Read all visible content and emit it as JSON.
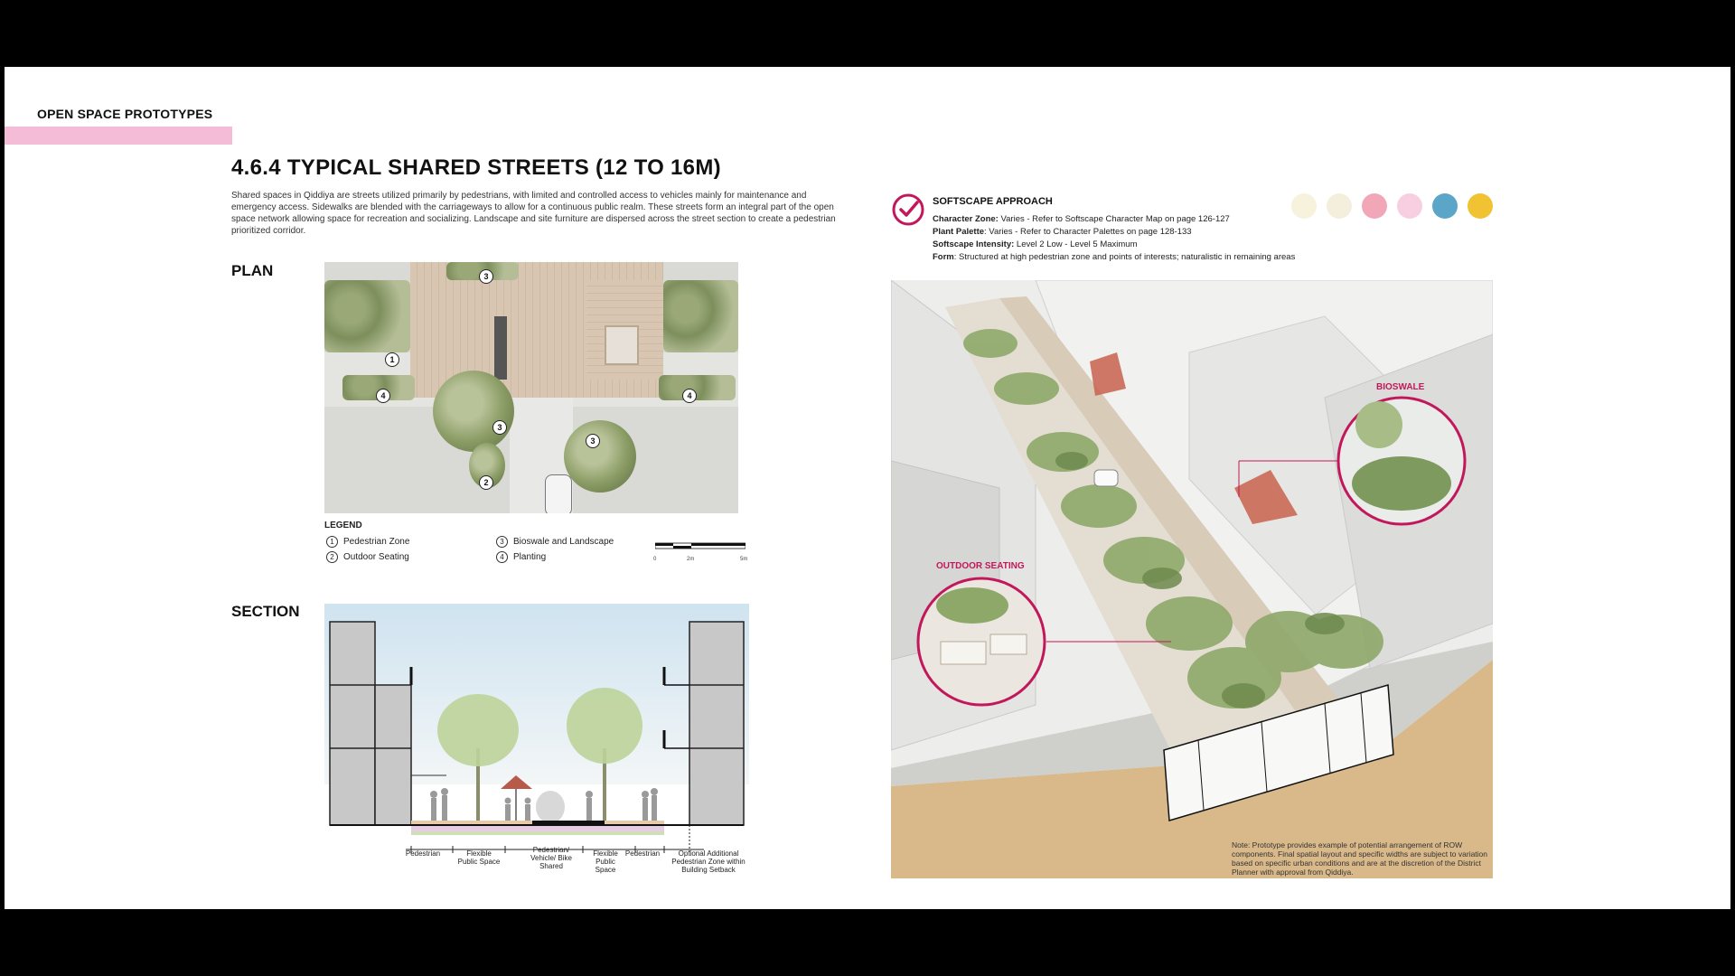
{
  "header": {
    "eyebrow": "OPEN SPACE PROTOTYPES",
    "title": "4.6.4 TYPICAL SHARED STREETS (12 TO 16M)",
    "intro": "Shared spaces in Qiddiya are streets utilized primarily by pedestrians, with limited and controlled access to vehicles mainly for maintenance and emergency access. Sidewalks are blended with the carriageways to allow for a continuous public realm. These streets form an integral part of the open space network allowing space for recreation and socializing. Landscape and site furniture are dispersed across the street section to create a pedestrian prioritized corridor."
  },
  "plan": {
    "label": "PLAN",
    "legend_title": "LEGEND",
    "legend": [
      {
        "num": "1",
        "text": "Pedestrian Zone"
      },
      {
        "num": "2",
        "text": "Outdoor Seating"
      },
      {
        "num": "3",
        "text": "Bioswale and Landscape"
      },
      {
        "num": "4",
        "text": "Planting"
      }
    ],
    "scale": {
      "s0": "0",
      "s1": "2m",
      "s2": "5m"
    },
    "pins": [
      "3",
      "1",
      "4",
      "4",
      "3",
      "3",
      "2"
    ]
  },
  "section": {
    "label": "SECTION",
    "zones": [
      "Pedestrian",
      "Flexible Public Space",
      "Pedestrian/ Vehicle/ Bike Shared",
      "Flexible Public Space",
      "Pedestrian",
      "Optional Additional Pedestrian Zone within Building Setback"
    ]
  },
  "softscape": {
    "title": "SOFTSCAPE APPROACH",
    "character_zone_label": "Character Zone:",
    "character_zone": "Varies - Refer to Softscape Character Map on page 126-127",
    "plant_palette_label": "Plant Palette",
    "plant_palette": ": Varies - Refer to Character Palettes on page 128-133",
    "intensity_label": "Softscape Intensity:",
    "intensity": "Level 2 Low - Level 5 Maximum",
    "form_label": "Form",
    "form": ": Structured at high pedestrian zone and points of interests; naturalistic in remaining areas",
    "icons": [
      {
        "name": "character-icon-1",
        "color": "#f6f2dc"
      },
      {
        "name": "character-icon-2",
        "color": "#f3efdc"
      },
      {
        "name": "character-icon-3",
        "color": "#f2a7b8"
      },
      {
        "name": "character-icon-4",
        "color": "#f7cfe0"
      },
      {
        "name": "character-icon-5",
        "color": "#5aa5c8"
      },
      {
        "name": "character-icon-6",
        "color": "#f1c232"
      }
    ]
  },
  "axon": {
    "bioswale": "BIOSWALE",
    "outdoor_seating": "OUTDOOR SEATING",
    "zones": [
      "PEDESTRIAN",
      "FLEXIBLE PUBLIC SPACE",
      "PEDESTRIAN/ VEHICLE/ BIKE SHARED",
      "FLEXIBLE PUBLIC SPACE",
      "PEDESTRIAN"
    ]
  },
  "note": "Note: Prototype provides example of potential arrangement of ROW components. Final spatial layout and specific widths are subject to variation based on specific urban conditions and are at the discretion of the District Planner with approval from Qiddiya.",
  "colors": {
    "accent": "#c2185b",
    "pink_bar": "#f5bcd8"
  }
}
